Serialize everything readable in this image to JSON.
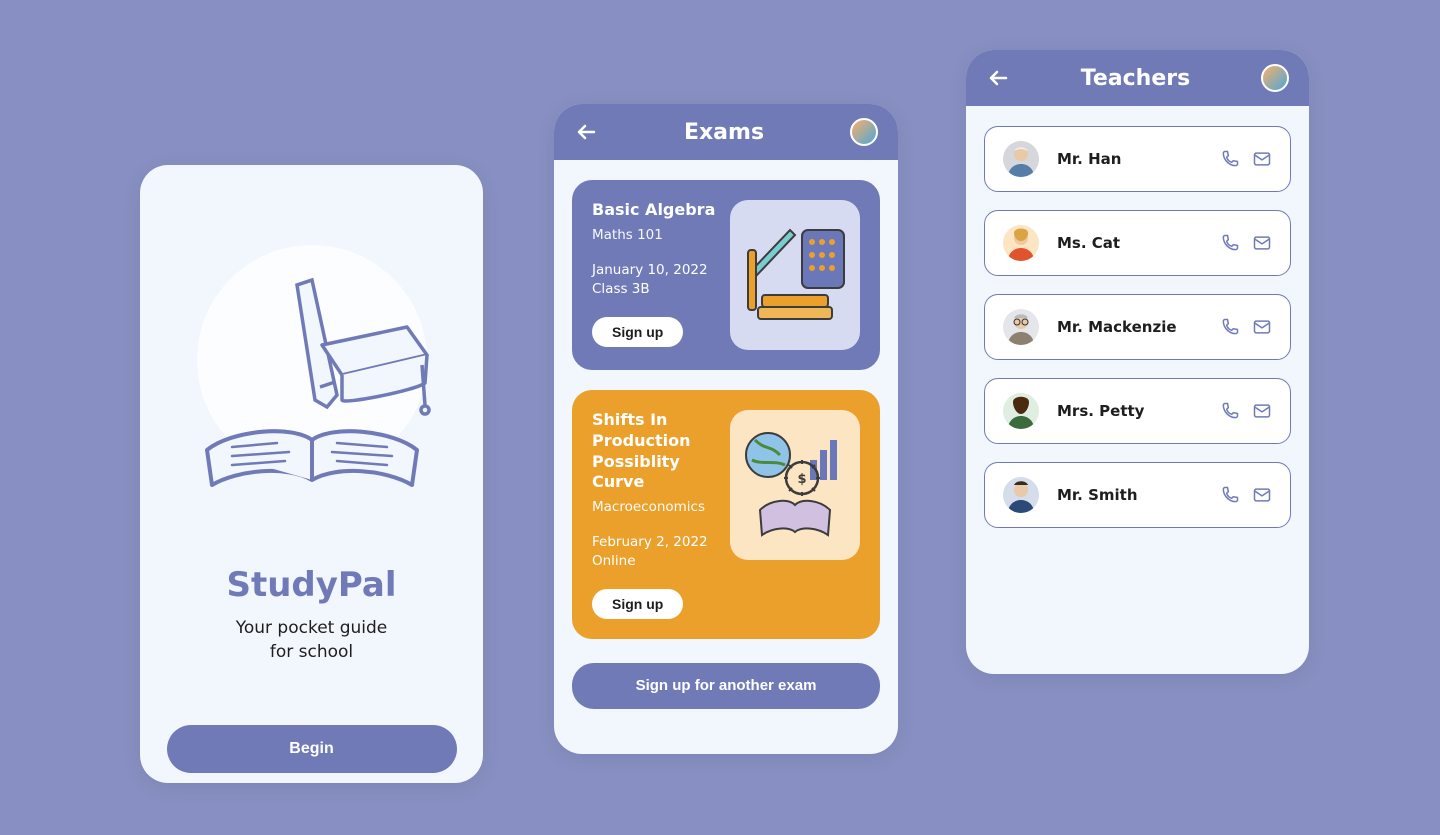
{
  "splash": {
    "app_name": "StudyPal",
    "tagline_l1": "Your pocket guide",
    "tagline_l2": "for school",
    "begin": "Begin"
  },
  "exams": {
    "title": "Exams",
    "another": "Sign up for another exam",
    "items": [
      {
        "title": "Basic Algebra",
        "subject": "Maths 101",
        "date": "January 10, 2022",
        "location": "Class 3B",
        "action": "Sign up"
      },
      {
        "title_l1": "Shifts In Production",
        "title_l2": "Possiblity Curve",
        "subject": "Macroeconomics",
        "date": "February 2, 2022",
        "location": "Online",
        "action": "Sign up"
      }
    ]
  },
  "teachers": {
    "title": "Teachers",
    "items": [
      {
        "name": "Mr. Han"
      },
      {
        "name": "Ms. Cat"
      },
      {
        "name": "Mr. Mackenzie"
      },
      {
        "name": "Mrs. Petty"
      },
      {
        "name": "Mr. Smith"
      }
    ]
  }
}
